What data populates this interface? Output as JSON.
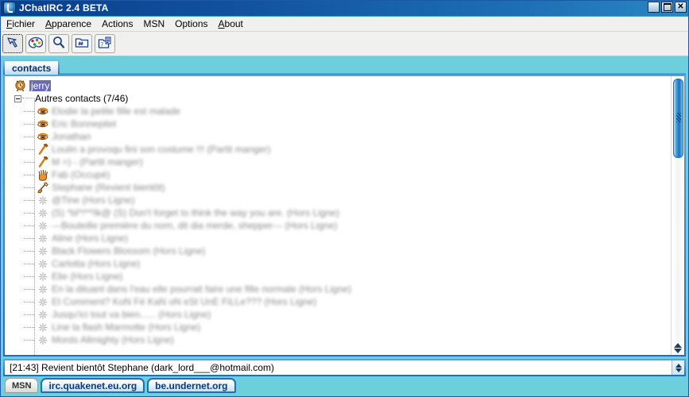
{
  "window": {
    "title": "JChatIRC 2.4 BETA",
    "icon": "app-logo-icon",
    "buttons": {
      "minimize": "_",
      "maximize": "",
      "close": "✕"
    }
  },
  "menubar": {
    "items": [
      {
        "mnemonic": "F",
        "rest": "ichier"
      },
      {
        "mnemonic": "A",
        "rest": "pparence"
      },
      {
        "mnemonic": "A",
        "rest": "ctions"
      },
      {
        "mnemonic": "M",
        "rest": "SN"
      },
      {
        "mnemonic": "O",
        "rest": "ptions"
      },
      {
        "mnemonic": "A",
        "rest": "bout"
      }
    ]
  },
  "toolbar": {
    "buttons": [
      {
        "name": "lightning-cursor-icon",
        "selected": true
      },
      {
        "name": "palette-icon",
        "selected": false
      },
      {
        "name": "search-magnifier-icon",
        "selected": false
      },
      {
        "name": "channel-folder-icon",
        "selected": false
      },
      {
        "name": "contacts-folder-icon",
        "selected": false
      }
    ]
  },
  "tabs": {
    "active": "contacts",
    "items": [
      {
        "label": "contacts"
      }
    ]
  },
  "tree": {
    "root": {
      "label": "jerry",
      "icon": "clock-icon",
      "selected": true
    },
    "group": {
      "label": "Autres contacts (7/46)",
      "expanded": true
    },
    "contacts": [
      {
        "label": "Elodie la petite fille est malade",
        "icon": "eye-icon",
        "blurred": true
      },
      {
        "label": "Eric Bonnepitet",
        "icon": "eye-icon",
        "blurred": true
      },
      {
        "label": "Jonathan",
        "icon": "eye-icon",
        "blurred": true
      },
      {
        "label": "Loulin a provoqu fini son costume !!! (Partit manger)",
        "icon": "fork-icon",
        "blurred": true,
        "suffix": "(Partit manger)"
      },
      {
        "label": "M =) - (Partit manger)",
        "icon": "fork-icon",
        "blurred": true
      },
      {
        "label": "Fab (Occupé)",
        "icon": "hand-icon",
        "blurred": true
      },
      {
        "label": "Stephane (Revient bientôt)",
        "icon": "pen-icon",
        "blurred": true
      },
      {
        "label": "@Tine (Hors Ligne)",
        "icon": "offline-star-icon",
        "blurred": true
      },
      {
        "label": "(S) *bl*!**!lk@ (S) Don't forget to think the way you are. (Hors Ligne)",
        "icon": "offline-star-icon",
        "blurred": true,
        "suffix": "to think the way you are. (Hors Ligne)"
      },
      {
        "label": "---Bouteille première du nom, dit dia merde, shepper--- (Hors Ligne)",
        "icon": "offline-star-icon",
        "blurred": true,
        "suffix": "merde, shepper--- (Hors Ligne)"
      },
      {
        "label": "Aline (Hors Ligne)",
        "icon": "offline-star-icon",
        "blurred": true
      },
      {
        "label": "Black Flowers Blossom (Hors Ligne)",
        "icon": "offline-star-icon",
        "blurred": true
      },
      {
        "label": "Carlotta (Hors Ligne)",
        "icon": "offline-star-icon",
        "blurred": true
      },
      {
        "label": "Elie (Hors Ligne)",
        "icon": "offline-star-icon",
        "blurred": true
      },
      {
        "label": "En la diluant dans l'eau elle pourrait faire une fille normale (Hors Ligne)",
        "icon": "offline-star-icon",
        "blurred": true,
        "suffix": "faire une fille normale (Hors Ligne)"
      },
      {
        "label": "Et Comment? KoN Fé KaN oN eSt UnE FiLLe??? (Hors Ligne)",
        "icon": "offline-star-icon",
        "blurred": true,
        "suffix": "oN eSt UnE FiLLe??? (Hors Ligne)"
      },
      {
        "label": "Jusqu'ici tout va bien...... (Hors Ligne)",
        "icon": "offline-star-icon",
        "blurred": true,
        "suffix": "(Hors Ligne)"
      },
      {
        "label": "Line la flash Marmotte (Hors Ligne)",
        "icon": "offline-star-icon",
        "blurred": true,
        "suffix": "(Hors Ligne)"
      },
      {
        "label": "Mords Allmighty (Hors Ligne)",
        "icon": "offline-star-icon",
        "blurred": true,
        "suffix": "(Hors Ligne)"
      }
    ]
  },
  "statusbar": {
    "value": "[21:43] Revient bientôt Stephane (dark_lord___@hotmail.com)"
  },
  "bottom_tabs": [
    {
      "label": "MSN",
      "active": false
    },
    {
      "label": "irc.quakenet.eu.org",
      "active": true
    },
    {
      "label": "be.undernet.org",
      "active": true
    }
  ],
  "colors": {
    "title_start": "#0a3e8c",
    "title_end": "#2a86c4",
    "window_bg": "#6ecfdc",
    "selection": "#6a6ab8",
    "tab_border": "#1f6fb8"
  }
}
